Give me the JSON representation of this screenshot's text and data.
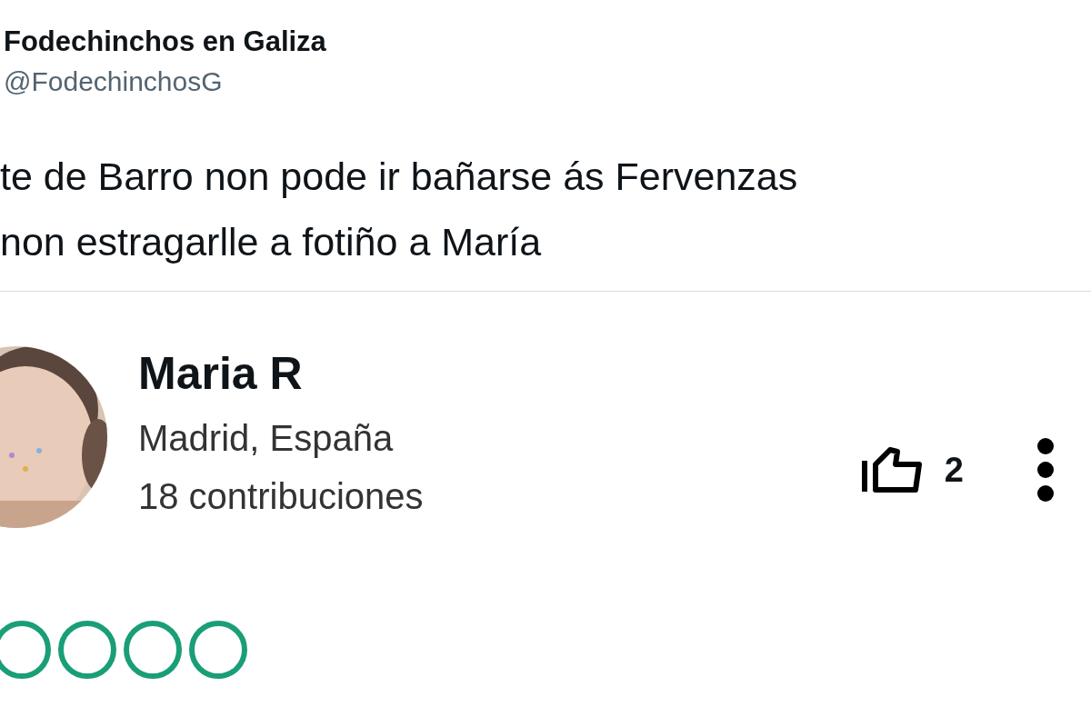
{
  "tweet": {
    "author": "Fodechinchos en Galiza",
    "handle": "@FodechinchosG",
    "lines": [
      "te de Barro non pode ir bañarse ás Fervenzas",
      "non estragarlle a fotiño a María"
    ]
  },
  "review": {
    "name": "Maria R",
    "location": "Madrid, España",
    "contributions": "18 contribuciones",
    "likes": "2",
    "stars": 0
  }
}
